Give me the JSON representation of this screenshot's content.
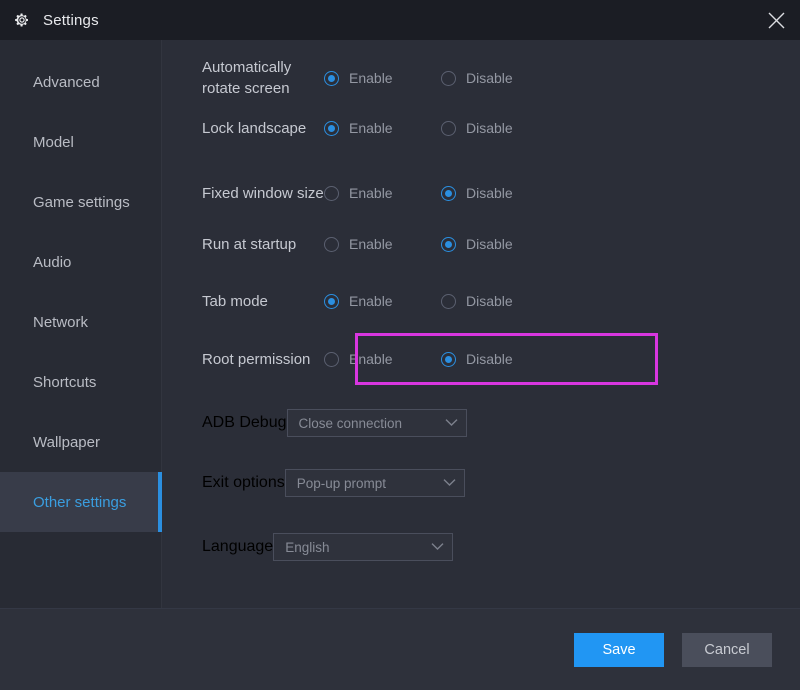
{
  "window": {
    "title": "Settings",
    "gear_icon": "gear-icon",
    "close_icon": "close-icon"
  },
  "sidebar": {
    "items": [
      {
        "label": "Advanced",
        "active": false
      },
      {
        "label": "Model",
        "active": false
      },
      {
        "label": "Game settings",
        "active": false
      },
      {
        "label": "Audio",
        "active": false
      },
      {
        "label": "Network",
        "active": false
      },
      {
        "label": "Shortcuts",
        "active": false
      },
      {
        "label": "Wallpaper",
        "active": false
      },
      {
        "label": "Other settings",
        "active": true
      }
    ],
    "accent_color": "#2b8fe0"
  },
  "main": {
    "toggle_rows": [
      {
        "label": "Automatically rotate screen",
        "enable_label": "Enable",
        "disable_label": "Disable",
        "selected": "Enable",
        "highlighted": false
      },
      {
        "label": "Lock landscape",
        "enable_label": "Enable",
        "disable_label": "Disable",
        "selected": "Enable",
        "highlighted": false
      },
      {
        "label": "Fixed window size",
        "enable_label": "Enable",
        "disable_label": "Disable",
        "selected": "Disable",
        "highlighted": false
      },
      {
        "label": "Run at startup",
        "enable_label": "Enable",
        "disable_label": "Disable",
        "selected": "Disable",
        "highlighted": false
      },
      {
        "label": "Tab mode",
        "enable_label": "Enable",
        "disable_label": "Disable",
        "selected": "Enable",
        "highlighted": false
      },
      {
        "label": "Root permission",
        "enable_label": "Enable",
        "disable_label": "Disable",
        "selected": "Disable",
        "highlighted": true
      }
    ],
    "select_rows": [
      {
        "label": "ADB Debug",
        "value": "Close connection",
        "chevron_icon": "chevron-down-icon"
      },
      {
        "label": "Exit options",
        "value": "Pop-up prompt",
        "chevron_icon": "chevron-down-icon"
      },
      {
        "label": "Language",
        "value": "English",
        "chevron_icon": "chevron-down-icon"
      }
    ],
    "highlight_color": "#d836e0"
  },
  "footer": {
    "save_label": "Save",
    "cancel_label": "Cancel",
    "save_color": "#2196f3"
  }
}
